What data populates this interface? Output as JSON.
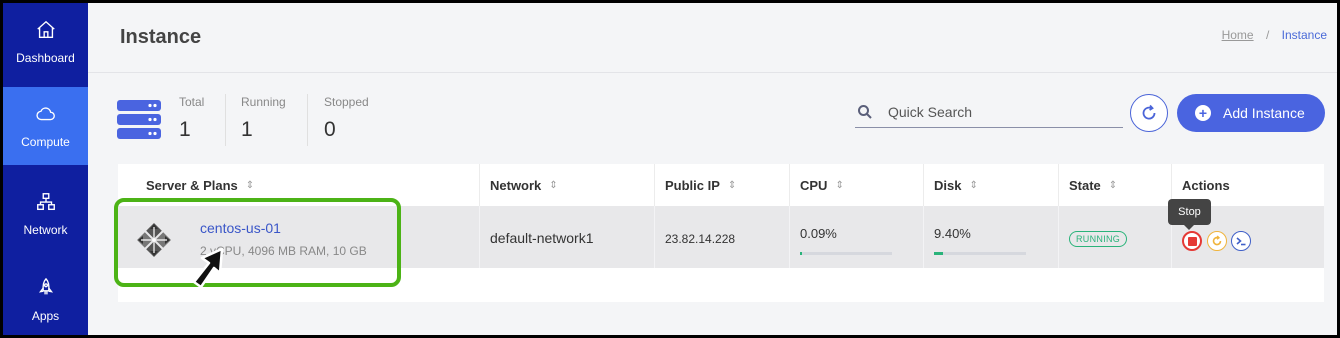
{
  "sidebar": {
    "items": [
      {
        "label": "Dashboard",
        "icon": "home-icon"
      },
      {
        "label": "Compute",
        "icon": "cloud-icon",
        "active": true
      },
      {
        "label": "Network",
        "icon": "network-icon"
      },
      {
        "label": "Apps",
        "icon": "rocket-icon"
      }
    ]
  },
  "header": {
    "title": "Instance",
    "breadcrumb": {
      "home": "Home",
      "separator": "/",
      "current": "Instance"
    }
  },
  "stats": {
    "icon": "server-stack-icon",
    "total_label": "Total",
    "total_value": "1",
    "running_label": "Running",
    "running_value": "1",
    "stopped_label": "Stopped",
    "stopped_value": "0"
  },
  "toolbar": {
    "search_placeholder": "Quick Search",
    "add_label": "Add Instance"
  },
  "table": {
    "columns": [
      "Server & Plans",
      "Network",
      "Public IP",
      "CPU",
      "Disk",
      "State",
      "Actions"
    ],
    "rows": [
      {
        "name": "centos-us-01",
        "spec": "2 vCPU, 4096 MB RAM, 10 GB",
        "network": "default-network1",
        "public_ip": "23.82.14.228",
        "cpu": "0.09%",
        "cpu_fraction": 0.0009,
        "disk": "9.40%",
        "disk_fraction": 0.094,
        "state": "RUNNING"
      }
    ]
  },
  "tooltip": "Stop",
  "colors": {
    "sidebar": "#0f1fa0",
    "sidebar_active": "#3a6ff0",
    "accent": "#4a64e0",
    "running": "#2ab37a",
    "stop": "#e53935",
    "restart": "#f0b43c",
    "console": "#3f5fc8",
    "highlight": "#4cb316"
  }
}
